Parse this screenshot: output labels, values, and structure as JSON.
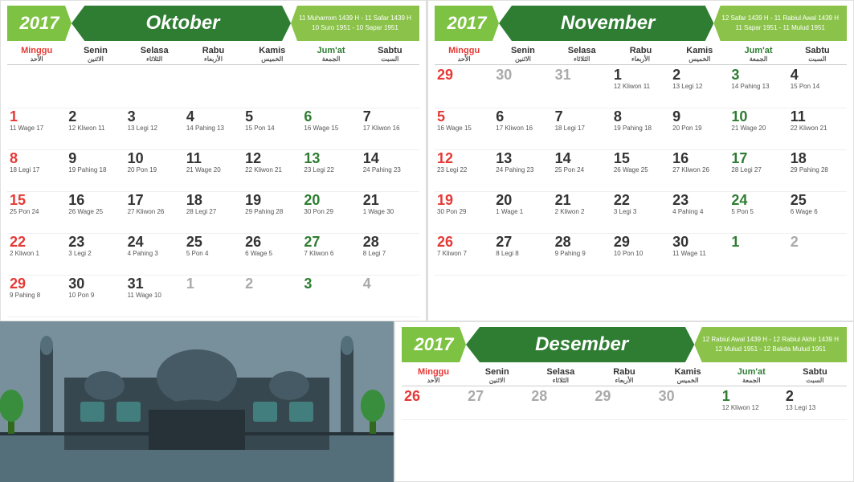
{
  "oktober": {
    "year": "2017",
    "month": "Oktober",
    "hijri1": "11 Muharrom 1439 H - 11 Safar 1439 H",
    "hijri2": "10 Suro 1951 - 10 Sapar 1951",
    "days": [
      "Minggu",
      "Senin",
      "Selasa",
      "Rabu",
      "Kamis",
      "Jum'at",
      "Sabtu"
    ],
    "arabic_days": [
      "الأحد",
      "الاثنين",
      "الثلاثاء",
      "الأربعاء",
      "الخميس",
      "الجمعة",
      "السبت"
    ],
    "cells": [
      {
        "n": "",
        "corner": "",
        "saka": "",
        "ar": ""
      },
      {
        "n": "",
        "corner": "",
        "saka": "",
        "ar": ""
      },
      {
        "n": "",
        "corner": "",
        "saka": "",
        "ar": ""
      },
      {
        "n": "",
        "corner": "",
        "saka": "",
        "ar": ""
      },
      {
        "n": "",
        "corner": "",
        "saka": "",
        "ar": ""
      },
      {
        "n": "",
        "corner": "",
        "saka": "",
        "ar": ""
      },
      {
        "n": "",
        "corner": "",
        "saka": "",
        "ar": ""
      },
      {
        "n": "1",
        "corner": "",
        "saka": "11 Wage 17",
        "ar": "",
        "type": "sunday"
      },
      {
        "n": "2",
        "corner": "",
        "saka": "12 Kliwon 11",
        "ar": ""
      },
      {
        "n": "3",
        "corner": "",
        "saka": "13 Legi 12",
        "ar": ""
      },
      {
        "n": "4",
        "corner": "",
        "saka": "14 Pahing 13",
        "ar": ""
      },
      {
        "n": "5",
        "corner": "",
        "saka": "15 Pon 14",
        "ar": ""
      },
      {
        "n": "6",
        "corner": "",
        "saka": "16 Wage 15",
        "ar": "",
        "type": "friday"
      },
      {
        "n": "7",
        "corner": "",
        "saka": "17 Kliwon 16",
        "ar": ""
      },
      {
        "n": "8",
        "corner": "",
        "saka": "18 Legi 17",
        "ar": "",
        "type": "sunday"
      },
      {
        "n": "9",
        "corner": "",
        "saka": "19 Pahing 18",
        "ar": ""
      },
      {
        "n": "10",
        "corner": "",
        "saka": "20 Pon 19",
        "ar": ""
      },
      {
        "n": "11",
        "corner": "",
        "saka": "21 Wage 20",
        "ar": ""
      },
      {
        "n": "12",
        "corner": "",
        "saka": "22 Kliwon 21",
        "ar": ""
      },
      {
        "n": "13",
        "corner": "",
        "saka": "23 Legi 22",
        "ar": "",
        "type": "friday"
      },
      {
        "n": "14",
        "corner": "",
        "saka": "24 Pahing 23",
        "ar": ""
      },
      {
        "n": "15",
        "corner": "",
        "saka": "25 Pon 24",
        "ar": "",
        "type": "sunday"
      },
      {
        "n": "16",
        "corner": "",
        "saka": "26 Wage 25",
        "ar": ""
      },
      {
        "n": "17",
        "corner": "",
        "saka": "27 Kliwon 26",
        "ar": ""
      },
      {
        "n": "18",
        "corner": "",
        "saka": "28 Legi 27",
        "ar": ""
      },
      {
        "n": "19",
        "corner": "",
        "saka": "29 Pahing 28",
        "ar": ""
      },
      {
        "n": "20",
        "corner": "",
        "saka": "30 Pon 29",
        "ar": "",
        "type": "friday"
      },
      {
        "n": "21",
        "corner": "",
        "saka": "1 Wage 30",
        "ar": ""
      },
      {
        "n": "22",
        "corner": "",
        "saka": "2 Kliwon 1",
        "ar": "",
        "type": "sunday"
      },
      {
        "n": "23",
        "corner": "",
        "saka": "3 Legi 2",
        "ar": ""
      },
      {
        "n": "24",
        "corner": "",
        "saka": "4 Pahing 3",
        "ar": ""
      },
      {
        "n": "25",
        "corner": "",
        "saka": "5 Pon 4",
        "ar": ""
      },
      {
        "n": "26",
        "corner": "",
        "saka": "6 Wage 5",
        "ar": ""
      },
      {
        "n": "27",
        "corner": "",
        "saka": "7 Kliwon 6",
        "ar": "",
        "type": "friday"
      },
      {
        "n": "28",
        "corner": "",
        "saka": "8 Legi 7",
        "ar": ""
      },
      {
        "n": "29",
        "corner": "",
        "saka": "9 Pahing 8",
        "ar": "",
        "type": "sunday"
      },
      {
        "n": "30",
        "corner": "",
        "saka": "10 Pon 9",
        "ar": ""
      },
      {
        "n": "31",
        "corner": "",
        "saka": "11 Wage 10",
        "ar": ""
      },
      {
        "n": "1",
        "corner": "",
        "saka": "",
        "ar": "",
        "type": "other"
      },
      {
        "n": "2",
        "corner": "",
        "saka": "",
        "ar": "",
        "type": "other"
      },
      {
        "n": "3",
        "corner": "",
        "saka": "",
        "ar": "",
        "type": "other-friday"
      },
      {
        "n": "4",
        "corner": "",
        "saka": "",
        "ar": "",
        "type": "other"
      }
    ]
  },
  "november": {
    "year": "2017",
    "month": "November",
    "hijri1": "12 Safar 1439 H - 11 Rabiul Awal 1439 H",
    "hijri2": "11 Sapar 1951 - 11 Mulud 1951",
    "days": [
      "Minggu",
      "Senin",
      "Selasa",
      "Rabu",
      "Kamis",
      "Jum'at",
      "Sabtu"
    ],
    "arabic_days": [
      "الأحد",
      "الاثنين",
      "الثلاثاء",
      "الأربعاء",
      "الخميس",
      "الجمعة",
      "السبت"
    ],
    "cells": [
      {
        "n": "29",
        "corner": "",
        "saka": "",
        "ar": "",
        "type": "other-sunday"
      },
      {
        "n": "30",
        "corner": "",
        "saka": "",
        "ar": "",
        "type": "other"
      },
      {
        "n": "31",
        "corner": "",
        "saka": "",
        "ar": "",
        "type": "other"
      },
      {
        "n": "1",
        "corner": "",
        "saka": "12 Kliwon 11",
        "ar": ""
      },
      {
        "n": "2",
        "corner": "",
        "saka": "13 Legi 12",
        "ar": ""
      },
      {
        "n": "3",
        "corner": "",
        "saka": "14 Pahing 13",
        "ar": "",
        "type": "friday"
      },
      {
        "n": "4",
        "corner": "",
        "saka": "15 Pon 14",
        "ar": ""
      },
      {
        "n": "5",
        "corner": "",
        "saka": "16 Wage 15",
        "ar": "",
        "type": "sunday"
      },
      {
        "n": "6",
        "corner": "",
        "saka": "17 Kliwon 16",
        "ar": ""
      },
      {
        "n": "7",
        "corner": "",
        "saka": "18 Legi 17",
        "ar": ""
      },
      {
        "n": "8",
        "corner": "",
        "saka": "19 Pahing 18",
        "ar": ""
      },
      {
        "n": "9",
        "corner": "",
        "saka": "20 Pon 19",
        "ar": ""
      },
      {
        "n": "10",
        "corner": "",
        "saka": "21 Wage 20",
        "ar": "",
        "type": "friday"
      },
      {
        "n": "11",
        "corner": "",
        "saka": "22 Kliwon 21",
        "ar": ""
      },
      {
        "n": "12",
        "corner": "",
        "saka": "23 Legi 22",
        "ar": "",
        "type": "sunday"
      },
      {
        "n": "13",
        "corner": "",
        "saka": "24 Pahing 23",
        "ar": ""
      },
      {
        "n": "14",
        "corner": "",
        "saka": "25 Pon 24",
        "ar": ""
      },
      {
        "n": "15",
        "corner": "",
        "saka": "26 Wage 25",
        "ar": ""
      },
      {
        "n": "16",
        "corner": "",
        "saka": "27 Kliwon 26",
        "ar": ""
      },
      {
        "n": "17",
        "corner": "",
        "saka": "28 Legi 27",
        "ar": "",
        "type": "friday"
      },
      {
        "n": "18",
        "corner": "",
        "saka": "29 Pahing 28",
        "ar": ""
      },
      {
        "n": "19",
        "corner": "",
        "saka": "30 Pon 29",
        "ar": "",
        "type": "sunday"
      },
      {
        "n": "20",
        "corner": "",
        "saka": "1 Wage 1",
        "ar": ""
      },
      {
        "n": "21",
        "corner": "",
        "saka": "2 Kliwon 2",
        "ar": ""
      },
      {
        "n": "22",
        "corner": "",
        "saka": "3 Legi 3",
        "ar": ""
      },
      {
        "n": "23",
        "corner": "",
        "saka": "4 Pahing 4",
        "ar": ""
      },
      {
        "n": "24",
        "corner": "",
        "saka": "5 Pon 5",
        "ar": "",
        "type": "friday"
      },
      {
        "n": "25",
        "corner": "",
        "saka": "6 Wage 6",
        "ar": ""
      },
      {
        "n": "26",
        "corner": "",
        "saka": "7 Kliwon 7",
        "ar": "",
        "type": "sunday"
      },
      {
        "n": "27",
        "corner": "",
        "saka": "8 Legi 8",
        "ar": ""
      },
      {
        "n": "28",
        "corner": "",
        "saka": "9 Pahing 9",
        "ar": ""
      },
      {
        "n": "29",
        "corner": "",
        "saka": "10 Pon 10",
        "ar": ""
      },
      {
        "n": "30",
        "corner": "",
        "saka": "11 Wage 11",
        "ar": ""
      },
      {
        "n": "1",
        "corner": "",
        "saka": "",
        "ar": "",
        "type": "other-friday"
      },
      {
        "n": "2",
        "corner": "",
        "saka": "",
        "ar": "",
        "type": "other"
      }
    ]
  },
  "desember": {
    "year": "2017",
    "month": "Desember",
    "hijri1": "12 Rabiul Awal 1439 H - 12 Rabiul Akhir 1439 H",
    "hijri2": "12 Mulud 1951 - 12 Bakda Mulud 1951",
    "days": [
      "Minggu",
      "Senin",
      "Selasa",
      "Rabu",
      "Kamis",
      "Jum'at",
      "Sabtu"
    ],
    "arabic_days": [
      "الأحد",
      "الاثنين",
      "الثلاثاء",
      "الأربعاء",
      "الخميس",
      "الجمعة",
      "السبت"
    ],
    "cells": [
      {
        "n": "26",
        "corner": "",
        "saka": "",
        "ar": "",
        "type": "other-sunday"
      },
      {
        "n": "27",
        "corner": "",
        "saka": "",
        "ar": "",
        "type": "other"
      },
      {
        "n": "28",
        "corner": "",
        "saka": "",
        "ar": "",
        "type": "other"
      },
      {
        "n": "29",
        "corner": "",
        "saka": "",
        "ar": "",
        "type": "other"
      },
      {
        "n": "30",
        "corner": "",
        "saka": "",
        "ar": "",
        "type": "other"
      },
      {
        "n": "1",
        "corner": "",
        "saka": "12 Kliwon 12",
        "ar": "",
        "type": "friday"
      },
      {
        "n": "2",
        "corner": "",
        "saka": "13 Legi 13",
        "ar": ""
      }
    ]
  }
}
